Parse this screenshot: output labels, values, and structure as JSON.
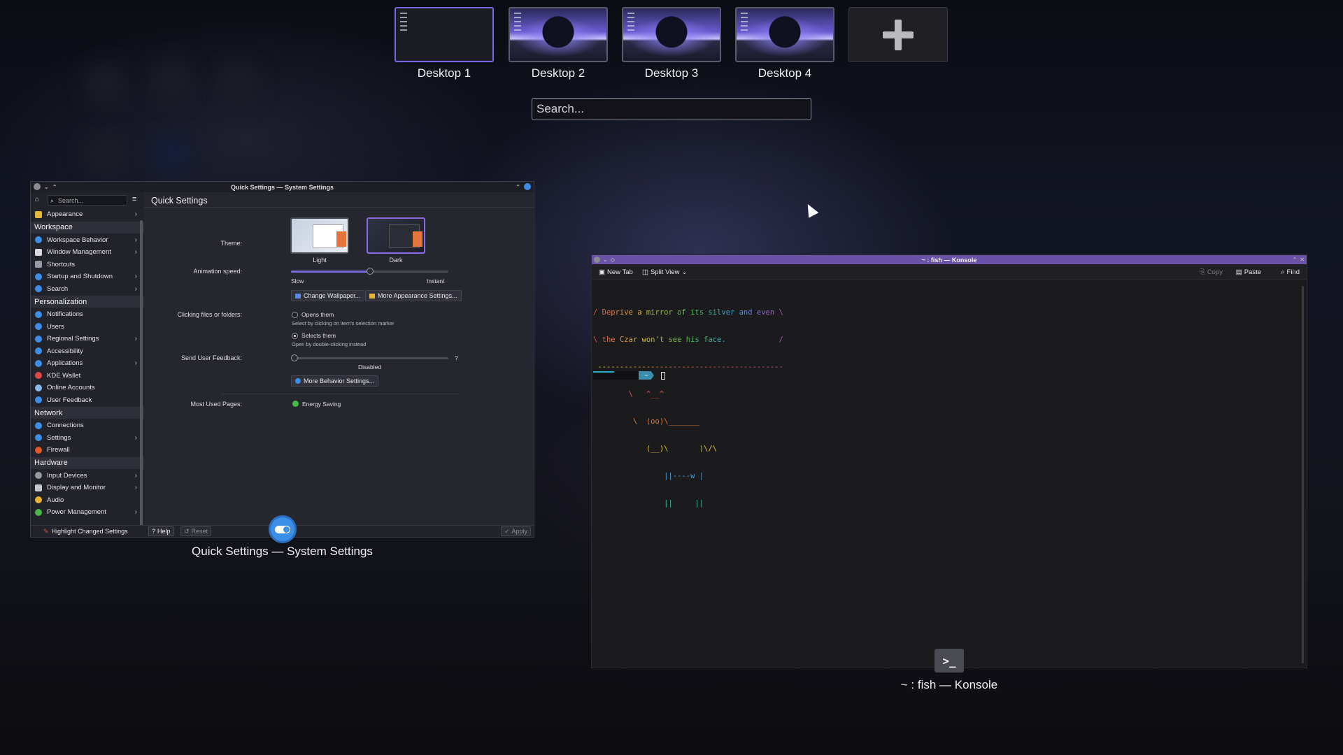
{
  "desktops": [
    {
      "label": "Desktop 1"
    },
    {
      "label": "Desktop 2"
    },
    {
      "label": "Desktop 3"
    },
    {
      "label": "Desktop 4"
    }
  ],
  "search": {
    "placeholder": "Search..."
  },
  "system_settings": {
    "title": "Quick Settings — System Settings",
    "caption": "Quick Settings — System Settings",
    "sidebar_search_placeholder": "Search...",
    "page_title": "Quick Settings",
    "sidebar": {
      "appearance": "Appearance",
      "workspace_header": "Workspace",
      "workspace_behavior": "Workspace Behavior",
      "window_management": "Window Management",
      "shortcuts": "Shortcuts",
      "startup_shutdown": "Startup and Shutdown",
      "search": "Search",
      "personalization_header": "Personalization",
      "notifications": "Notifications",
      "users": "Users",
      "regional_settings": "Regional Settings",
      "accessibility": "Accessibility",
      "applications": "Applications",
      "kde_wallet": "KDE Wallet",
      "online_accounts": "Online Accounts",
      "user_feedback": "User Feedback",
      "network_header": "Network",
      "connections": "Connections",
      "settings": "Settings",
      "firewall": "Firewall",
      "hardware_header": "Hardware",
      "input_devices": "Input Devices",
      "display_monitor": "Display and Monitor",
      "audio": "Audio",
      "power_management": "Power Management"
    },
    "theme_label": "Theme:",
    "theme_light": "Light",
    "theme_dark": "Dark",
    "animation_label": "Animation speed:",
    "animation_slow": "Slow",
    "animation_instant": "Instant",
    "animation_value": 0.5,
    "change_wallpaper": "Change Wallpaper...",
    "more_appearance": "More Appearance Settings...",
    "clicking_label": "Clicking files or folders:",
    "opens_them": "Opens them",
    "opens_hint": "Select by clicking on item's selection marker",
    "selects_them": "Selects them",
    "selects_hint": "Open by double-clicking instead",
    "feedback_label": "Send User Feedback:",
    "feedback_value": "Disabled",
    "feedback_help": "?",
    "more_behavior": "More Behavior Settings...",
    "most_used_label": "Most Used Pages:",
    "energy_saving": "Energy Saving",
    "highlight_changed": "Highlight Changed Settings",
    "help": "Help",
    "reset": "Reset",
    "apply": "Apply"
  },
  "konsole": {
    "title": "~ : fish — Konsole",
    "caption": "~ : fish — Konsole",
    "new_tab": "New Tab",
    "split_view": "Split View",
    "copy": "Copy",
    "paste": "Paste",
    "find": "Find",
    "prompt_dir": "~",
    "terminal_lines": [
      "/ Deprive a mirror of its silver and even \\",
      "\\ the Czar won't see his face.            /",
      " ------------------------------------------",
      "        \\   ^__^",
      "         \\  (oo)\\_______",
      "            (__)\\       )\\/\\",
      "                ||----w |",
      "                ||     ||"
    ]
  },
  "colors": {
    "accent": "#7a6ae0",
    "konsole_title": "#6a52a8",
    "brand_blue": "#3d8ee6"
  }
}
